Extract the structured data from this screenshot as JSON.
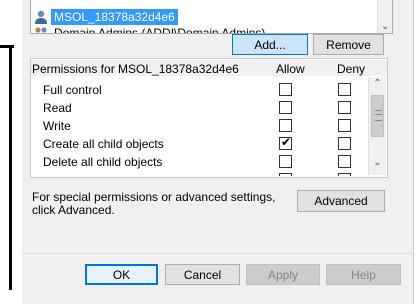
{
  "principals": {
    "items": [
      {
        "name": "MSOL_18378a32d4e6",
        "selected": true
      },
      {
        "name": "Domain Admins (ADDI\\Domain Admins)",
        "selected": false
      }
    ]
  },
  "buttons": {
    "add": "Add...",
    "remove": "Remove",
    "advanced": "Advanced",
    "ok": "OK",
    "cancel": "Cancel",
    "apply": "Apply",
    "help": "Help"
  },
  "permissions": {
    "header_label": "Permissions for MSOL_18378a32d4e6",
    "allow_label": "Allow",
    "deny_label": "Deny",
    "rows": [
      {
        "name": "Full control",
        "allow": false,
        "deny": false
      },
      {
        "name": "Read",
        "allow": false,
        "deny": false
      },
      {
        "name": "Write",
        "allow": false,
        "deny": false
      },
      {
        "name": "Create all child objects",
        "allow": true,
        "deny": false
      },
      {
        "name": "Delete all child objects",
        "allow": false,
        "deny": false
      }
    ]
  },
  "special": {
    "text": "For special permissions or advanced settings, click Advanced."
  },
  "colors": {
    "selection": "#3399ff",
    "focus_border": "#0078d7"
  }
}
